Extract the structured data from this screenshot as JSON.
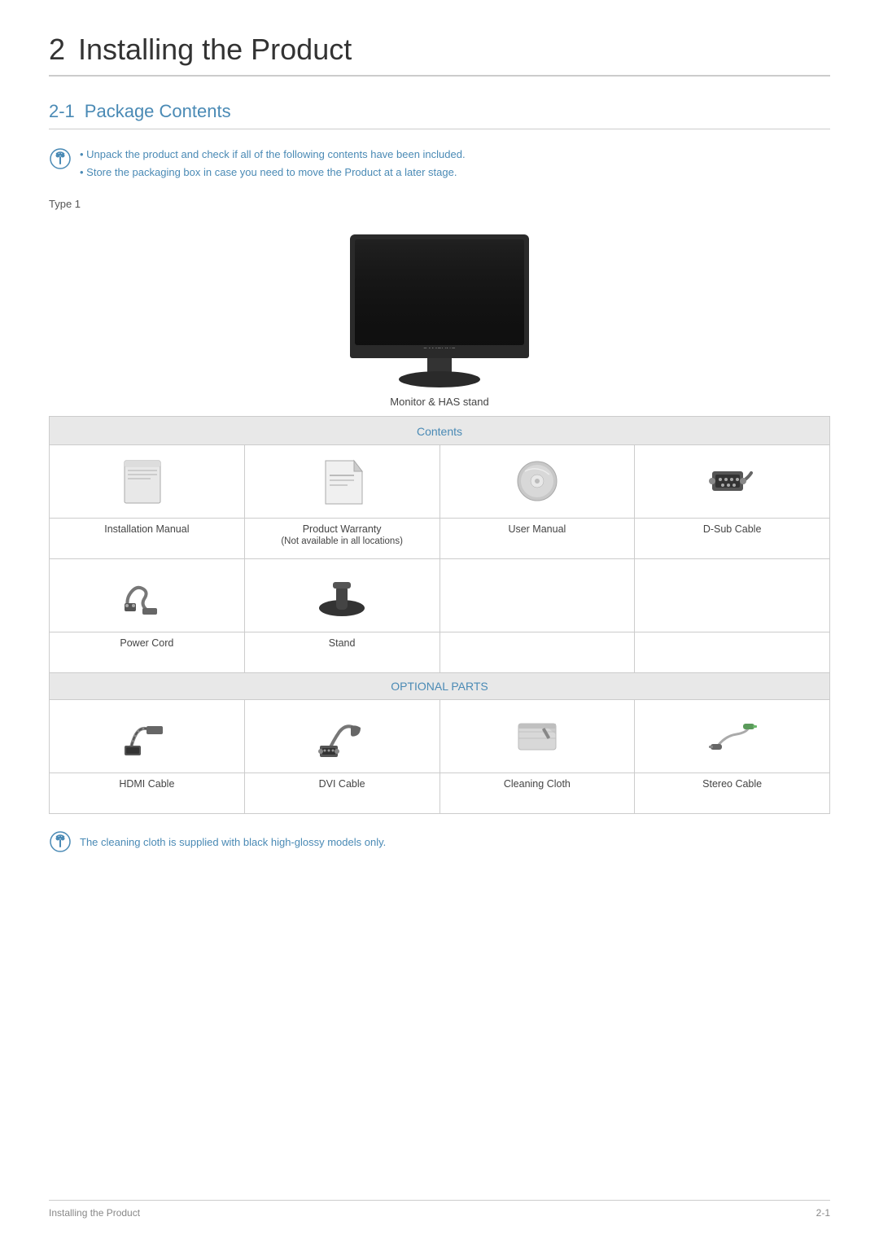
{
  "page": {
    "chapter_number": "2",
    "chapter_title": "Installing the Product",
    "section_number": "2-1",
    "section_title": "Package Contents"
  },
  "notices": {
    "top": [
      "Unpack the product and check if all of the following contents have been included.",
      "Store the packaging box in case you need to move the Product at a later stage."
    ],
    "bottom": "The cleaning cloth is supplied with black high-glossy models only."
  },
  "type_label": "Type 1",
  "monitor_label": "Monitor & HAS stand",
  "contents_header": "Contents",
  "optional_header": "OPTIONAL PARTS",
  "contents_items": [
    {
      "icon": "installation-manual-icon",
      "label": "Installation Manual"
    },
    {
      "icon": "product-warranty-icon",
      "label": "Product Warranty\n(Not available in all locations)"
    },
    {
      "icon": "user-manual-icon",
      "label": "User Manual"
    },
    {
      "icon": "dsub-cable-icon",
      "label": "D-Sub Cable"
    },
    {
      "icon": "power-cord-icon",
      "label": "Power Cord"
    },
    {
      "icon": "stand-icon",
      "label": "Stand"
    },
    {
      "icon": "empty1",
      "label": ""
    },
    {
      "icon": "empty2",
      "label": ""
    }
  ],
  "optional_items": [
    {
      "icon": "hdmi-cable-icon",
      "label": "HDMI Cable"
    },
    {
      "icon": "dvi-cable-icon",
      "label": "DVI Cable"
    },
    {
      "icon": "cleaning-cloth-icon",
      "label": "Cleaning Cloth"
    },
    {
      "icon": "stereo-cable-icon",
      "label": "Stereo Cable"
    }
  ],
  "footer": {
    "left": "Installing the Product",
    "right": "2-1"
  }
}
